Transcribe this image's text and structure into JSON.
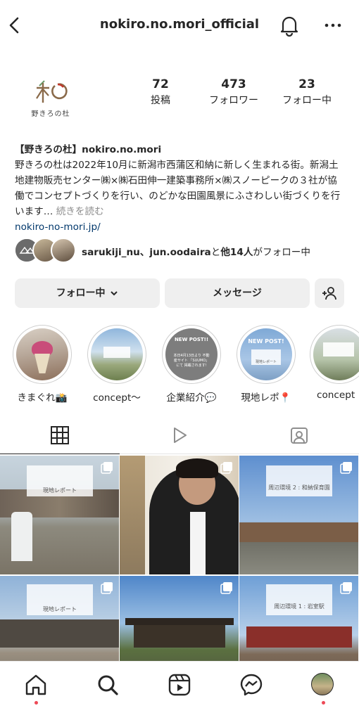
{
  "header": {
    "username": "nokiro.no.mori_official",
    "back_icon": "chevron-left-icon",
    "bell_icon": "bell-icon",
    "more_icon": "more-horizontal-icon"
  },
  "profile": {
    "logo_text": "野きろの杜",
    "stats": [
      {
        "value": "72",
        "label": "投稿"
      },
      {
        "value": "473",
        "label": "フォロワー"
      },
      {
        "value": "23",
        "label": "フォロー中"
      }
    ]
  },
  "bio": {
    "name": "【野きろの杜】nokiro.no.mori",
    "text": "野きろの杜は2022年10月に新潟市西蒲区和納に新しく生まれる街。新潟土地建物販売センター㈱×㈱石田伸一建築事務所×㈱スノーピークの３社が協働でコンセプトづくりを行い、のどかな田園風景にふさわしい街づくりを行います…",
    "more": " 続きを読む",
    "link": "nokiro-no-mori.jp/"
  },
  "mutual": {
    "names": "sarukiji_nu、jun.oodaira",
    "middle": "と",
    "others": "他14人",
    "suffix": "がフォロー中"
  },
  "buttons": {
    "follow": "フォロー中",
    "message": "メッセージ",
    "add_user_icon": "add-user-icon"
  },
  "stories": [
    {
      "label": "きまぐれ📸"
    },
    {
      "label": "concept～"
    },
    {
      "label": "企業紹介💬"
    },
    {
      "label": "現地レポ📍"
    },
    {
      "label": "concept"
    }
  ],
  "story_text": {
    "s3_title": "NEW POST!!",
    "s3_sub": "本日4月13日より 不動産サイト 「SUUMO」にて 掲載されます!",
    "s4_title": "NEW POST!",
    "s4_sub": "現地レポート"
  },
  "posts": [
    {
      "caption": "現地レポート"
    },
    {
      "caption": ""
    },
    {
      "caption": "周辺環境 2 : 和納保育園"
    },
    {
      "caption": "現地レポート"
    },
    {
      "caption": ""
    },
    {
      "caption": "周辺環境 1 : 岩室駅"
    }
  ],
  "tabs": [
    "grid-icon",
    "reels-icon",
    "tagged-icon"
  ],
  "nav": [
    "home-icon",
    "search-icon",
    "reels-icon",
    "messenger-icon",
    "profile-avatar"
  ]
}
